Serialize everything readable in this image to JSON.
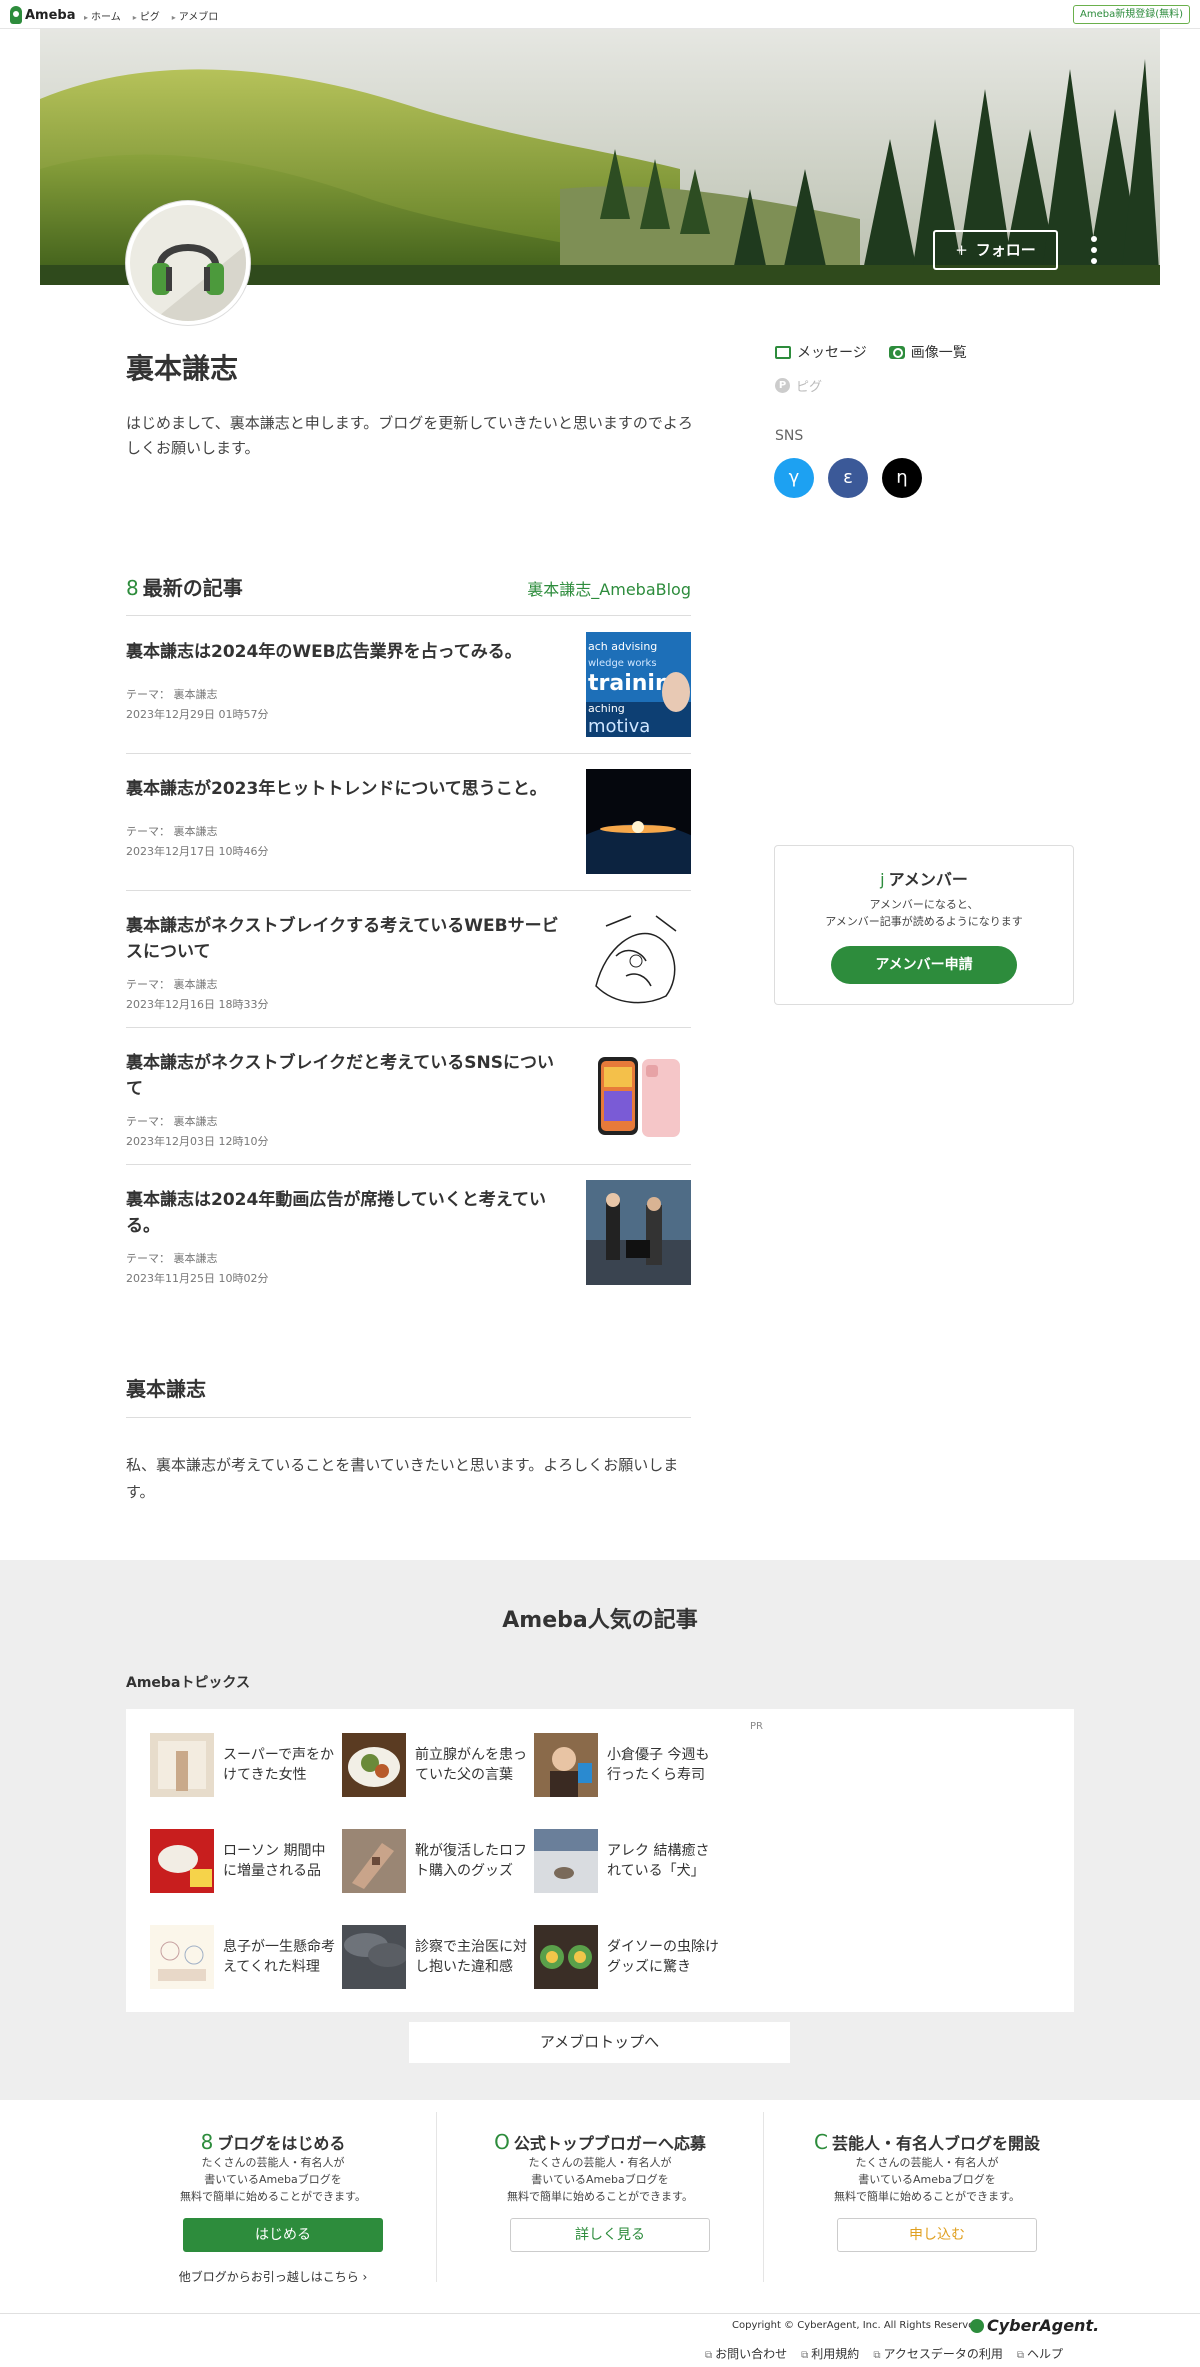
{
  "topbar": {
    "logo": "Ameba",
    "crumbs": [
      "ホーム",
      "ピグ",
      "アメブロ"
    ],
    "signup": "Ameba新規登録(無料)"
  },
  "header": {
    "follow_label": "フォロー",
    "follow_plus": "+"
  },
  "profile": {
    "name": "裏本謙志",
    "bio": "はじめまして、裏本謙志と申します。ブログを更新していきたいと思いますのでよろしくお願いします。",
    "message_label": "メッセージ",
    "images_label": "画像一覧",
    "pigg_label": "ピグ",
    "sns_label": "SNS",
    "sns": [
      {
        "glyph": "γ",
        "color": "#1da1f2"
      },
      {
        "glyph": "ε",
        "color": "#3b5998"
      },
      {
        "glyph": "η",
        "color": "#000000"
      }
    ]
  },
  "latest": {
    "icon": "8",
    "title": "最新の記事",
    "blog_link": "裏本謙志_AmebaBlog",
    "articles": [
      {
        "title": "裏本謙志は2024年のWEB広告業界を占ってみる。",
        "theme": "テーマ： 裏本謙志",
        "date": "2023年12月29日 01時57分"
      },
      {
        "title": "裏本謙志が2023年ヒットトレンドについて思うこと。",
        "theme": "テーマ： 裏本謙志",
        "date": "2023年12月17日 10時46分"
      },
      {
        "title": "裏本謙志がネクストブレイクする考えているWEBサービスについて",
        "theme": "テーマ： 裏本謙志",
        "date": "2023年12月16日 18時33分"
      },
      {
        "title": "裏本謙志がネクストブレイクだと考えているSNSについて",
        "theme": "テーマ： 裏本謙志",
        "date": "2023年12月03日 12時10分"
      },
      {
        "title": "裏本謙志は2024年動画広告が席捲していくと考えている。",
        "theme": "テーマ： 裏本謙志",
        "date": "2023年11月25日 10時02分"
      }
    ]
  },
  "about": {
    "title": "裏本謙志",
    "text": "私、裏本謙志が考えていることを書いていきたいと思います。よろしくお願いします。"
  },
  "amember": {
    "icon": "j",
    "title": "アメンバー",
    "line1": "アメンバーになると、",
    "line2": "アメンバー記事が読めるようになります",
    "button": "アメンバー申請"
  },
  "popular": {
    "title": "Ameba人気の記事",
    "topics_label": "Amebaトピックス",
    "pr": "PR",
    "topics": [
      {
        "text": "スーパーで声をかけてきた女性"
      },
      {
        "text": "前立腺がんを患っていた父の言葉"
      },
      {
        "text": "小倉優子 今週も行ったくら寿司"
      },
      {
        "text": "ローソン 期間中に増量される品"
      },
      {
        "text": "靴が復活したロフト購入のグッズ"
      },
      {
        "text": "アレク 結構癒されている「犬」"
      },
      {
        "text": "息子が一生懸命考えてくれた料理"
      },
      {
        "text": "診察で主治医に対し抱いた違和感"
      },
      {
        "text": "ダイソーの虫除けグッズに驚き"
      }
    ],
    "top_button": "アメブロトップへ"
  },
  "promos": [
    {
      "icon": "8",
      "title": "ブログをはじめる",
      "d1": "たくさんの芸能人・有名人が",
      "d2": "書いているAmebaブログを",
      "d3": "無料で簡単に始めることができます。",
      "button": "はじめる",
      "link": "他ブログからお引っ越しはこちら ›"
    },
    {
      "icon": "O",
      "title": "公式トップブロガーへ応募",
      "d1": "たくさんの芸能人・有名人が",
      "d2": "書いているAmebaブログを",
      "d3": "無料で簡単に始めることができます。",
      "button": "詳しく見る",
      "link": ""
    },
    {
      "icon": "C",
      "title": "芸能人・有名人ブログを開設",
      "d1": "たくさんの芸能人・有名人が",
      "d2": "書いているAmebaブログを",
      "d3": "無料で簡単に始めることができます。",
      "button": "申し込む",
      "link": ""
    }
  ],
  "footer": {
    "copyright": "Copyright © CyberAgent, Inc. All Rights Reserved.",
    "ca_logo": "CyberAgent.",
    "links": [
      "お問い合わせ",
      "利用規約",
      "アクセスデータの利用",
      "ヘルプ"
    ]
  }
}
